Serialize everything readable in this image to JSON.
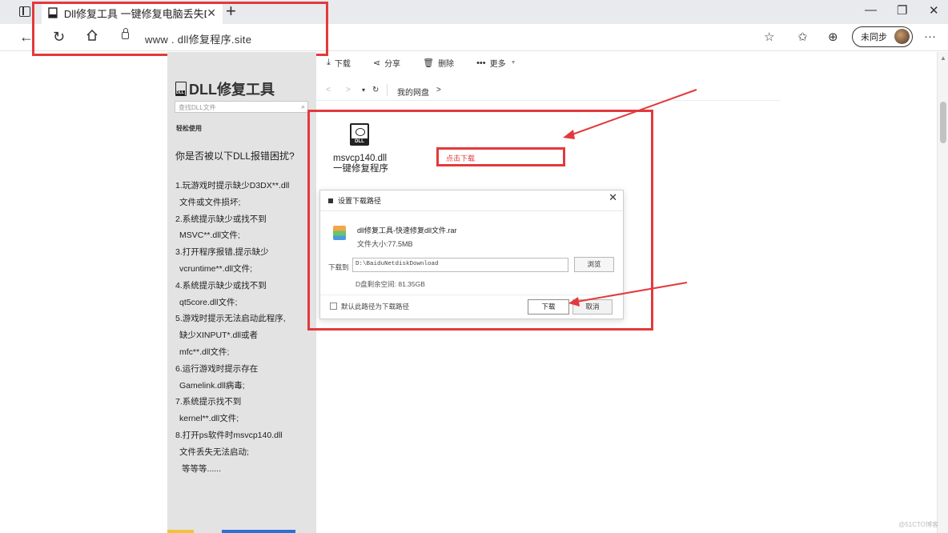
{
  "browser": {
    "tab_title": "Dll修复工具 一键修复电脑丢失D",
    "tab_close": "✕",
    "new_tab": "+",
    "url": "www . dll修复程序.site",
    "sync_label": "未同步",
    "more": "···"
  },
  "left_panel": {
    "logo_title": "DLL修复工具",
    "search_placeholder": "查找DLL文件",
    "subtitle": "轻松使用",
    "question": "你是否被以下DLL报错困扰?",
    "items": [
      "1.玩游戏时提示缺少D3DX**.dll",
      "文件或文件损坏;",
      "2.系统提示缺少或找不到",
      "MSVC**.dll文件;",
      "3.打开程序报错,提示缺少",
      "vcruntime**.dll文件;",
      "4.系统提示缺少或找不到",
      "qt5core.dll文件;",
      "5.游戏时提示无法启动此程序,",
      "缺少XINPUT*.dll或者",
      "mfc**.dll文件;",
      "6.运行游戏时提示存在",
      "Gamelink.dll病毒;",
      "7.系统提示找不到",
      "kernel**.dll文件;",
      "8.打开ps软件时msvcp140.dll",
      "文件丢失无法启动;",
      "等等等......"
    ]
  },
  "toolbar": {
    "download": "下载",
    "share": "分享",
    "delete": "删除",
    "more": "更多"
  },
  "pathbar": {
    "back": "<",
    "forward": ">",
    "dropdown": "▾",
    "refresh": "↻",
    "breadcrumb": "我的网盘",
    "sep": ">"
  },
  "file": {
    "name_line1": "msvcp140.dll",
    "name_line2": "一键修复程序"
  },
  "annotation": "点击下载",
  "dialog": {
    "title": "设置下载路径",
    "close": "✕",
    "file_name": "dll修复工具-快速修复dll文件.rar",
    "file_size": "文件大小:77.5MB",
    "download_to_label": "下载到",
    "path": "D:\\BaiduNetdiskDownload",
    "browse": "浏览",
    "free_space": "D盘剩余空间: 81.35GB",
    "default_path_label": "默认此路径为下载路径",
    "download_button": "下载",
    "cancel_button": "取消"
  },
  "watermark": "@51CTO博客",
  "colors": {
    "annotation_red": "#e3393c",
    "side_panel": "#e3e3e3",
    "tab_bar": "#e8eaed"
  }
}
